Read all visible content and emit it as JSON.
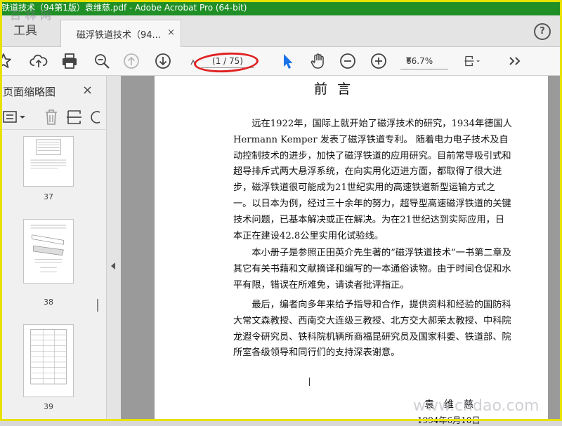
{
  "window": {
    "title": "铁道技术（94第1版）袁维慈.pdf - Adobe Acrobat Pro (64-bit)"
  },
  "tabs": {
    "tools_label": "工具",
    "document_label": "磁浮铁道技术（94...",
    "close_glyph": "×",
    "help_glyph": "?"
  },
  "toolbar": {
    "page_indicator": "(1 / 75)",
    "zoom_value": "66.7%",
    "icons": [
      "star-icon",
      "upload-cloud-icon",
      "print-icon",
      "zoom-search-icon",
      "prev-page-icon",
      "next-page-icon",
      "select-cursor-icon",
      "hand-tool-icon",
      "zoom-out-icon",
      "zoom-in-icon",
      "page-fit-icon",
      "more-tools-icon"
    ]
  },
  "sidebar": {
    "title": "页面缩略图",
    "close_glyph": "×",
    "thumbnails": [
      {
        "number": "37"
      },
      {
        "number": "38"
      },
      {
        "number": "39"
      }
    ]
  },
  "document": {
    "heading": "前言",
    "paragraphs": [
      "　　远在1922年，国际上就开始了磁浮技术的研究，1934年德国人Hermann Kemper 发表了磁浮铁道专利。 随着电力电子技术及自动控制技术的进步，加快了磁浮铁道的应用研究。目前常导吸引式和超导排斥式两大悬浮系统，在向实用化迈进方面，都取得了很大进步，磁浮铁道很可能成为21世纪实用的高速铁道新型运输方式之一。以日本为例，经过三十余年的努力，超导型高速磁浮铁道的关键技术问题，已基本解决或正在解决。为在21世纪达到实际应用，日本正在建设42.8公里实用化试验线。",
      "　　本小册子是参照正田英介先生著的”磁浮铁道技术”一书第二章及其它有关书藉和文献摘译和编写的一本通俗读物。由于时间仓促和水平有限，错误在所难免，请读者批评指正。",
      "　　最后，编者向多年来给予指导和合作，提供资料和经验的国防科大常文森教授、西南交大连级三教授、北方交大郝荣太教授、中科院龙遐令研究员、铁科院机辆所商福昆研究员及国家科委、铁道部、院所室各级领导和同行们的支持深表谢意。"
    ],
    "signature": "袁维慈",
    "date": "1994年6月10日"
  },
  "watermarks": {
    "top_left": "百 林 网",
    "bottom_right": "www.cndao.com"
  },
  "colors": {
    "titlebar": "#1f8f26",
    "annotation_ellipse": "#e02222",
    "select_tool": "#1a73e8",
    "frame": "#e8e200"
  }
}
